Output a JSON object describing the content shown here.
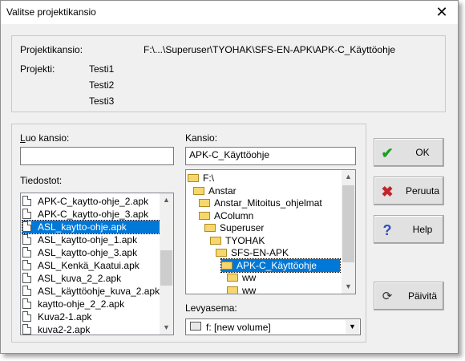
{
  "window": {
    "title": "Valitse projektikansio"
  },
  "project": {
    "folder_label": "Projektikansio:",
    "folder_value": "F:\\...\\Superuser\\TYOHAK\\SFS-EN-APK\\APK-C_Käyttöohje",
    "project_label": "Projekti:",
    "project_lines": [
      "Testi1",
      "Testi2",
      "Testi3"
    ]
  },
  "create_folder": {
    "label": "Luo kansio:",
    "value": ""
  },
  "files": {
    "label": "Tiedostot:",
    "items": [
      "APK-C_kaytto-ohje_2.apk",
      "APK-C_kaytto-ohje_3.apk",
      "ASL_kaytto-ohje.apk",
      "ASL_kaytto-ohje_1.apk",
      "ASL_kaytto-ohje_3.apk",
      "ASL_Kenkä_Kaatui.apk",
      "ASL_kuva_2_2.apk",
      "ASL_käyttöohje_kuva_2.apk",
      "kaytto-ohje_2_2.apk",
      "Kuva2-1.apk",
      "kuva2-2.apk"
    ],
    "selected_index": 2,
    "scroll_position": 0.55
  },
  "folder": {
    "label": "Kansio:",
    "value": "APK-C_Käyttöohje",
    "tree": [
      "F:\\",
      "Anstar",
      "Anstar_Mitoitus_ohjelmat",
      "AColumn",
      "Superuser",
      "TYOHAK",
      "SFS-EN-APK",
      "APK-C_Käyttöohje",
      "ww",
      "ww"
    ],
    "selected_index": 7,
    "scroll_position": 0.1
  },
  "drive": {
    "label": "Levyasema:",
    "value": "f: [new volume]"
  },
  "buttons": {
    "ok": "OK",
    "cancel": "Peruuta",
    "help": "Help",
    "refresh": "Päivitä"
  },
  "icons": {
    "ok": "checkmark-icon",
    "cancel": "x-icon",
    "help": "question-icon",
    "refresh": "refresh-icon"
  },
  "colors": {
    "selection": "#0078d7",
    "ok_icon": "#1e9e1e",
    "cancel_icon": "#c0262c",
    "help_icon": "#2a4fbf"
  }
}
